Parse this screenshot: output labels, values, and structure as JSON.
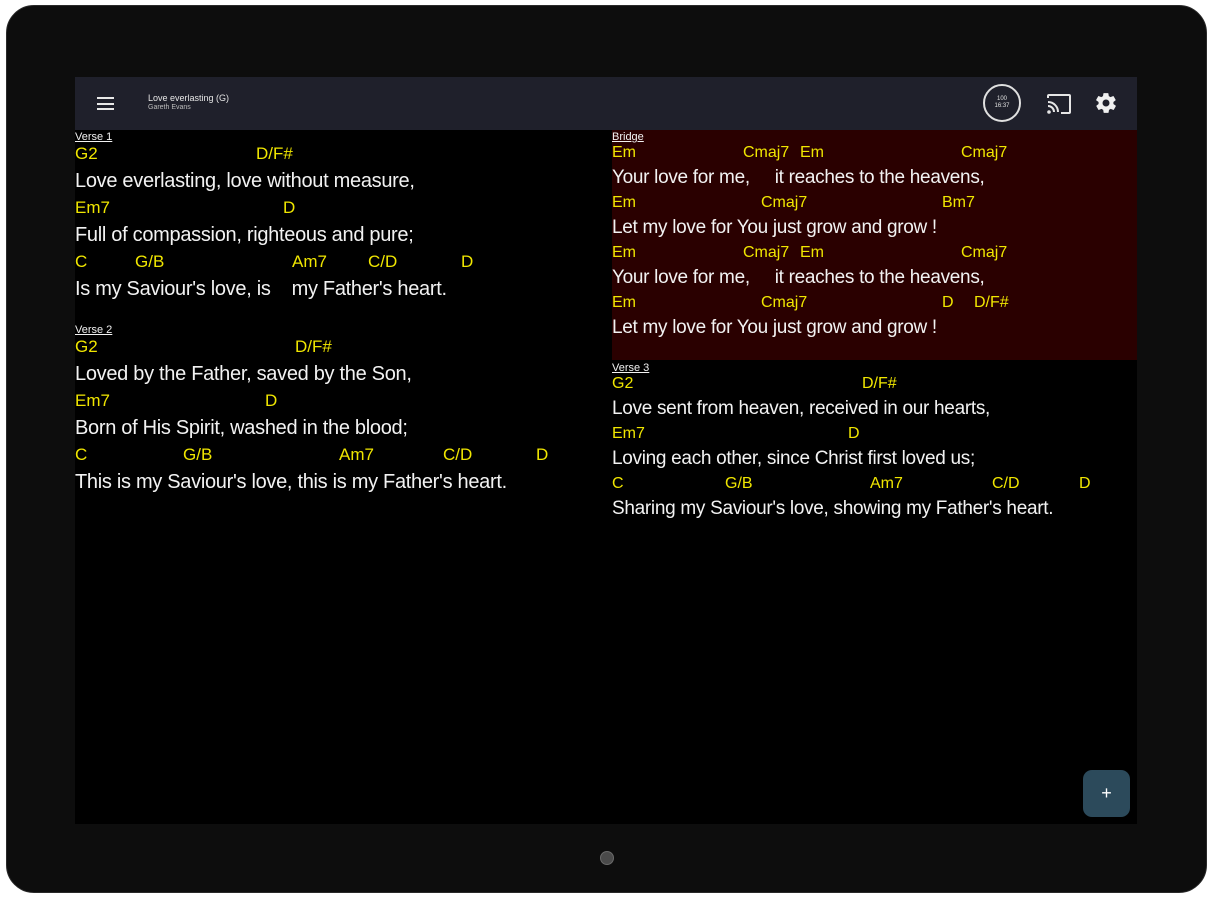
{
  "header": {
    "song_title": "Love everlasting (G)",
    "song_artist": "Gareth Evans",
    "tempo_line1": "100",
    "tempo_line2": "16:37",
    "menu_icon": "hamburger-menu-icon",
    "cast_icon": "cast-icon",
    "settings_icon": "gear-icon"
  },
  "colors": {
    "chord": "#f0e600",
    "lyric": "#f2f2f2",
    "bridge_highlight": "#2a0000",
    "toolbar": "#1f202b",
    "fab": "#2c4a5b"
  },
  "sections": [
    {
      "label": "Verse 1",
      "lines": [
        {
          "chords": [
            "G2",
            "D/F#"
          ],
          "lyric": "Love everlasting, love without measure,"
        },
        {
          "chords": [
            "Em7",
            "D"
          ],
          "lyric": "Full of compassion, righteous and pure;"
        },
        {
          "chords": [
            "C",
            "G/B",
            "Am7",
            "C/D",
            "D"
          ],
          "lyric": "Is my Saviour's love, is    my Father's heart."
        }
      ]
    },
    {
      "label": "Verse 2",
      "lines": [
        {
          "chords": [
            "G2",
            "D/F#"
          ],
          "lyric": "Loved by the Father, saved by the Son,"
        },
        {
          "chords": [
            "Em7",
            "D"
          ],
          "lyric": "Born of His Spirit, washed in the blood;"
        },
        {
          "chords": [
            "C",
            "G/B",
            "Am7",
            "C/D",
            "D"
          ],
          "lyric": "This is my Saviour's love, this is my Father's heart."
        }
      ]
    },
    {
      "label": "Bridge",
      "lines": [
        {
          "chords": [
            "Em",
            "Cmaj7",
            "Em",
            "Cmaj7"
          ],
          "lyric": "Your love for me,     it reaches to the heavens,"
        },
        {
          "chords": [
            "Em",
            "Cmaj7",
            "Bm7"
          ],
          "lyric": "Let my love for You just grow and grow !"
        },
        {
          "chords": [
            "Em",
            "Cmaj7",
            "Em",
            "Cmaj7"
          ],
          "lyric": "Your love for me,     it reaches to the heavens,"
        },
        {
          "chords": [
            "Em",
            "Cmaj7",
            "D",
            "D/F#"
          ],
          "lyric": "Let my love for You just grow and grow !"
        }
      ]
    },
    {
      "label": "Verse 3",
      "lines": [
        {
          "chords": [
            "G2",
            "D/F#"
          ],
          "lyric": "Love sent from heaven, received in our hearts,"
        },
        {
          "chords": [
            "Em7",
            "D"
          ],
          "lyric": "Loving each other, since Christ first loved us;"
        },
        {
          "chords": [
            "C",
            "G/B",
            "Am7",
            "C/D",
            "D"
          ],
          "lyric": "Sharing my Saviour's love, showing my Father's heart."
        }
      ]
    }
  ],
  "fab": {
    "label": "+",
    "icon": "plus-icon"
  }
}
